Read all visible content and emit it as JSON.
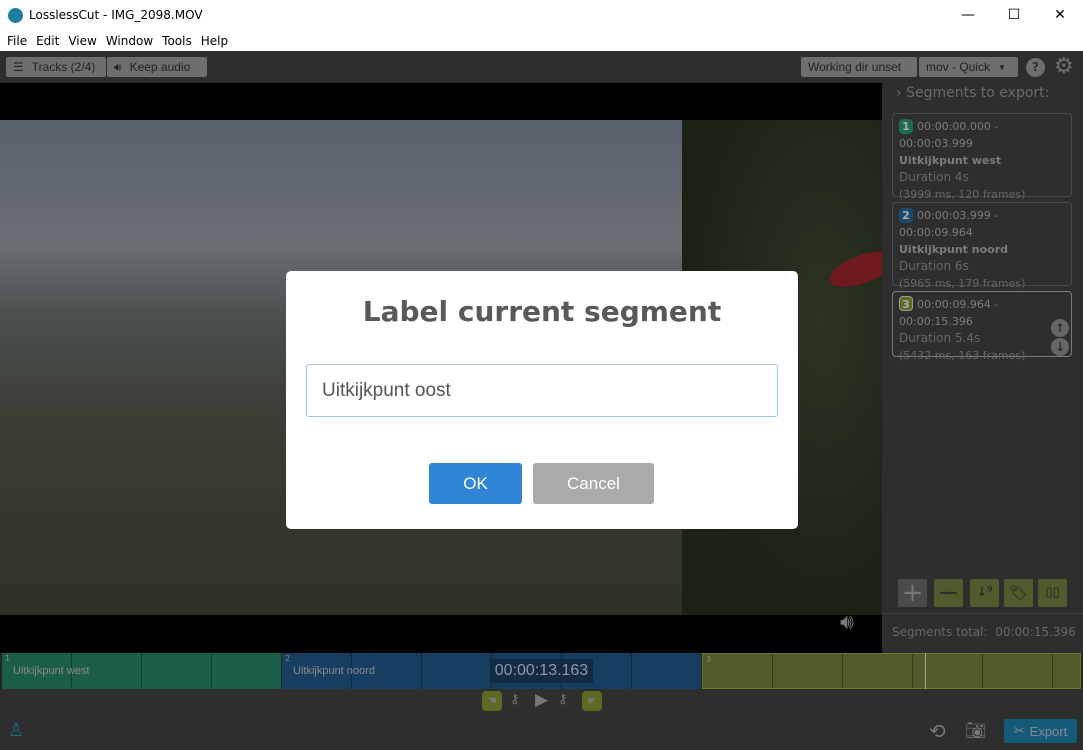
{
  "window": {
    "title": "LosslessCut - IMG_2098.MOV",
    "minimize": "—",
    "maximize": "☐",
    "close": "✕"
  },
  "menu": [
    "File",
    "Edit",
    "View",
    "Window",
    "Tools",
    "Help"
  ],
  "toolbar": {
    "tracks": "Tracks (2/4)",
    "keep_audio": "Keep audio",
    "working_dir": "Working dir unset",
    "format": "mov - Quick",
    "help": "?"
  },
  "sidebar": {
    "header": "Segments to export:",
    "segments": [
      {
        "num": "1",
        "range": "00:00:00.000 - 00:00:03.999",
        "name": "Uitkijkpunt west",
        "duration": "Duration 4s",
        "detail": "(3999 ms, 120 frames)",
        "color": "#1b6b50"
      },
      {
        "num": "2",
        "range": "00:00:03.999 - 00:00:09.964",
        "name": "Uitkijkpunt noord",
        "duration": "Duration 6s",
        "detail": "(5965 ms, 179 frames)",
        "color": "#1a4a72"
      },
      {
        "num": "3",
        "range": "00:00:09.964 - 00:00:15.396",
        "duration": "Duration 5.4s",
        "detail": "(5432 ms, 163 frames)",
        "color": "#5c6a22"
      }
    ],
    "total_label": "Segments total:",
    "total": "00:00:15.396"
  },
  "timeline": {
    "current_time": "00:00:13.163",
    "segments": [
      {
        "num": "1",
        "label": "Uitkijkpunt west"
      },
      {
        "num": "2",
        "label": "Uitkijkpunt noord"
      },
      {
        "num": "3",
        "label": ""
      }
    ]
  },
  "bottom": {
    "export": "Export"
  },
  "dialog": {
    "title": "Label current segment",
    "value": "Uitkijkpunt oost",
    "ok": "OK",
    "cancel": "Cancel"
  }
}
